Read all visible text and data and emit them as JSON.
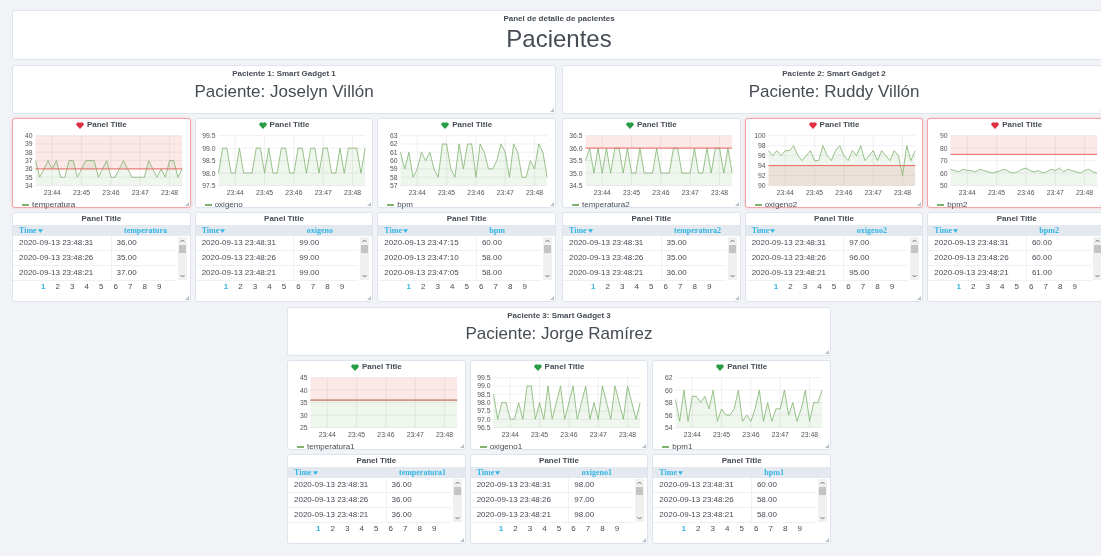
{
  "header": {
    "subtitle": "Panel de detalle de pacientes",
    "title": "Pacientes"
  },
  "patients": [
    {
      "subtitle": "Paciente 1: Smart Gadget 1",
      "title": "Paciente: Joselyn Villón",
      "graphs": [
        {
          "title": "Panel Title",
          "alerting": true,
          "chart_data": {
            "type": "area",
            "grid": true,
            "ylim": [
              34,
              40
            ],
            "yticks": [
              {
                "value": 34,
                "label": "34"
              },
              {
                "value": 35,
                "label": "35"
              },
              {
                "value": 36,
                "label": "36"
              },
              {
                "value": 37,
                "label": "37"
              },
              {
                "value": 38,
                "label": "38"
              },
              {
                "value": 39,
                "label": "39"
              },
              {
                "value": 40,
                "label": "40"
              }
            ],
            "ref_lines": [
              {
                "axis": "y",
                "value": 36
              }
            ],
            "bands": [
              {
                "axis": "y",
                "from": 36,
                "to": 40
              }
            ],
            "categories": [
              null,
              null,
              null,
              null,
              "23:44",
              null,
              null,
              null,
              null,
              null,
              null,
              "23:45",
              null,
              null,
              null,
              null,
              null,
              null,
              "23:46",
              null,
              null,
              null,
              null,
              null,
              null,
              "23:47",
              null,
              null,
              null,
              null,
              null,
              null,
              "23:48",
              null,
              null,
              null
            ],
            "series": [
              {
                "name": "temperatura",
                "color": "#7eb26d",
                "values": [
                  37,
                  35,
                  36,
                  37,
                  36,
                  37,
                  35,
                  35,
                  37,
                  37,
                  35,
                  36,
                  37,
                  37,
                  37,
                  35,
                  36,
                  37,
                  35,
                  35,
                  36,
                  37,
                  36,
                  35,
                  35,
                  35,
                  35,
                  37,
                  36,
                  35,
                  36,
                  35,
                  37,
                  37,
                  35,
                  36
                ]
              }
            ]
          }
        },
        {
          "title": "Panel Title",
          "alerting": false,
          "chart_data": {
            "type": "area",
            "grid": true,
            "ylim": [
              97.5,
              99.5
            ],
            "yticks": [
              {
                "value": 97.5,
                "label": "97.5"
              },
              {
                "value": 98,
                "label": "98.0"
              },
              {
                "value": 98.5,
                "label": "98.5"
              },
              {
                "value": 99,
                "label": "99.0"
              },
              {
                "value": 99.5,
                "label": "99.5"
              }
            ],
            "categories": [
              null,
              null,
              null,
              null,
              "23:44",
              null,
              null,
              null,
              null,
              null,
              null,
              "23:45",
              null,
              null,
              null,
              null,
              null,
              null,
              "23:46",
              null,
              null,
              null,
              null,
              null,
              null,
              "23:47",
              null,
              null,
              null,
              null,
              null,
              null,
              "23:48",
              null,
              null,
              null
            ],
            "series": [
              {
                "name": "oxigeno",
                "color": "#7eb26d",
                "values": [
                  98,
                  99,
                  99,
                  98,
                  98,
                  99,
                  98,
                  98,
                  98,
                  99,
                  99,
                  98,
                  99,
                  98,
                  98,
                  99,
                  99,
                  98,
                  98,
                  99,
                  99,
                  98,
                  99,
                  99,
                  98,
                  99,
                  99,
                  98,
                  98,
                  99,
                  98,
                  99,
                  99,
                  99,
                  98,
                  99
                ]
              }
            ]
          }
        },
        {
          "title": "Panel Title",
          "alerting": false,
          "chart_data": {
            "type": "area",
            "grid": true,
            "ylim": [
              57,
              63
            ],
            "yticks": [
              {
                "value": 57,
                "label": "57"
              },
              {
                "value": 58,
                "label": "58"
              },
              {
                "value": 59,
                "label": "59"
              },
              {
                "value": 60,
                "label": "60"
              },
              {
                "value": 61,
                "label": "61"
              },
              {
                "value": 62,
                "label": "62"
              },
              {
                "value": 63,
                "label": "63"
              }
            ],
            "categories": [
              null,
              null,
              null,
              null,
              "23:44",
              null,
              null,
              null,
              null,
              null,
              null,
              "23:45",
              null,
              null,
              null,
              null,
              null,
              null,
              "23:46",
              null,
              null,
              null,
              null,
              null,
              null,
              "23:47",
              null,
              null,
              null,
              null,
              null,
              null,
              "23:48",
              null,
              null,
              null
            ],
            "series": [
              {
                "name": "bpm",
                "color": "#7eb26d",
                "values": [
                  61,
                  59,
                  61,
                  58,
                  59,
                  61,
                  60,
                  61,
                  59,
                  58,
                  62,
                  62,
                  59,
                  58,
                  62,
                  59,
                  62,
                  62,
                  58,
                  62,
                  61,
                  59,
                  59,
                  60,
                  62,
                  61,
                  58,
                  62,
                  61,
                  58,
                  58,
                  60,
                  59,
                  62,
                  61,
                  58
                ]
              }
            ]
          }
        }
      ],
      "tables": [
        {
          "title": "Panel Title",
          "columns": [
            {
              "label": "Time",
              "sorted": true
            },
            {
              "label": "temperatura",
              "sorted": false
            }
          ],
          "rows": [
            [
              "2020-09-13 23:48:31",
              "36.00"
            ],
            [
              "2020-09-13 23:48:26",
              "35.00"
            ],
            [
              "2020-09-13 23:48:21",
              "37.00"
            ]
          ],
          "pages": [
            {
              "label": "1",
              "selected": true
            },
            {
              "label": "2",
              "selected": false
            },
            {
              "label": "3",
              "selected": false
            },
            {
              "label": "4",
              "selected": false
            },
            {
              "label": "5",
              "selected": false
            },
            {
              "label": "6",
              "selected": false
            },
            {
              "label": "7",
              "selected": false
            },
            {
              "label": "8",
              "selected": false
            },
            {
              "label": "9",
              "selected": false
            }
          ]
        },
        {
          "title": "Panel Title",
          "columns": [
            {
              "label": "Time",
              "sorted": true
            },
            {
              "label": "oxigeno",
              "sorted": false
            }
          ],
          "rows": [
            [
              "2020-09-13 23:48:31",
              "99.00"
            ],
            [
              "2020-09-13 23:48:26",
              "99.00"
            ],
            [
              "2020-09-13 23:48:21",
              "99.00"
            ]
          ],
          "pages": [
            {
              "label": "1",
              "selected": true
            },
            {
              "label": "2",
              "selected": false
            },
            {
              "label": "3",
              "selected": false
            },
            {
              "label": "4",
              "selected": false
            },
            {
              "label": "5",
              "selected": false
            },
            {
              "label": "6",
              "selected": false
            },
            {
              "label": "7",
              "selected": false
            },
            {
              "label": "8",
              "selected": false
            },
            {
              "label": "9",
              "selected": false
            }
          ]
        },
        {
          "title": "Panel Title",
          "columns": [
            {
              "label": "Time",
              "sorted": true
            },
            {
              "label": "bpm",
              "sorted": false
            }
          ],
          "rows": [
            [
              "2020-09-13 23:47:15",
              "60.00"
            ],
            [
              "2020-09-13 23:47:10",
              "58.00"
            ],
            [
              "2020-09-13 23:47:05",
              "58.00"
            ]
          ],
          "pages": [
            {
              "label": "1",
              "selected": true
            },
            {
              "label": "2",
              "selected": false
            },
            {
              "label": "3",
              "selected": false
            },
            {
              "label": "4",
              "selected": false
            },
            {
              "label": "5",
              "selected": false
            },
            {
              "label": "6",
              "selected": false
            },
            {
              "label": "7",
              "selected": false
            },
            {
              "label": "8",
              "selected": false
            },
            {
              "label": "9",
              "selected": false
            }
          ]
        }
      ]
    },
    {
      "subtitle": "Paciente 2: Smart Gadget 2",
      "title": "Paciente: Ruddy Villón",
      "graphs": [
        {
          "title": "Panel Title",
          "alerting": false,
          "chart_data": {
            "type": "area",
            "grid": true,
            "ylim": [
              34.5,
              36.5
            ],
            "yticks": [
              {
                "value": 34.5,
                "label": "34.5"
              },
              {
                "value": 35,
                "label": "35.0"
              },
              {
                "value": 35.5,
                "label": "35.5"
              },
              {
                "value": 36,
                "label": "36.0"
              },
              {
                "value": 36.5,
                "label": "36.5"
              }
            ],
            "ref_lines": [
              {
                "axis": "y",
                "value": 36
              }
            ],
            "bands": [
              {
                "axis": "y",
                "from": 36,
                "to": 36.5
              }
            ],
            "categories": [
              null,
              null,
              null,
              null,
              "23:44",
              null,
              null,
              null,
              null,
              null,
              null,
              "23:45",
              null,
              null,
              null,
              null,
              null,
              null,
              "23:46",
              null,
              null,
              null,
              null,
              null,
              null,
              "23:47",
              null,
              null,
              null,
              null,
              null,
              null,
              "23:48",
              null,
              null,
              null
            ],
            "series": [
              {
                "name": "temperatura2",
                "color": "#7eb26d",
                "values": [
                  35.5,
                  36,
                  35,
                  36,
                  35,
                  36,
                  35,
                  36,
                  36,
                  35,
                  36,
                  35,
                  35,
                  36,
                  35,
                  35,
                  35,
                  36,
                  35,
                  35,
                  35,
                  36,
                  36,
                  35,
                  35,
                  35,
                  36,
                  35,
                  35,
                  36,
                  35,
                  36,
                  36,
                  35,
                  36,
                  35
                ]
              }
            ]
          }
        },
        {
          "title": "Panel Title",
          "alerting": true,
          "chart_data": {
            "type": "area",
            "grid": true,
            "ylim": [
              90,
              100
            ],
            "yticks": [
              {
                "value": 90,
                "label": "90"
              },
              {
                "value": 92,
                "label": "92"
              },
              {
                "value": 94,
                "label": "94"
              },
              {
                "value": 96,
                "label": "96"
              },
              {
                "value": 98,
                "label": "98"
              },
              {
                "value": 100,
                "label": "100"
              }
            ],
            "ref_lines": [
              {
                "axis": "y",
                "value": 94
              }
            ],
            "bands": [
              {
                "axis": "y",
                "from": 90,
                "to": 94
              }
            ],
            "categories": [
              null,
              null,
              null,
              null,
              "23:44",
              null,
              null,
              null,
              null,
              null,
              null,
              "23:45",
              null,
              null,
              null,
              null,
              null,
              null,
              "23:46",
              null,
              null,
              null,
              null,
              null,
              null,
              "23:47",
              null,
              null,
              null,
              null,
              null,
              null,
              "23:48",
              null,
              null,
              null
            ],
            "series": [
              {
                "name": "oxigeno2",
                "color": "#7eb26d",
                "values": [
                  97,
                  96,
                  97,
                  96,
                  97,
                  97,
                  98,
                  96,
                  95,
                  96,
                  97,
                  95,
                  95,
                  98,
                  96,
                  95,
                  97,
                  98,
                  96,
                  95,
                  97,
                  96,
                  98,
                  95,
                  96,
                  97,
                  95,
                  97,
                  96,
                  95,
                  97,
                  96,
                  92,
                  98,
                  95,
                  97
                ]
              }
            ]
          }
        },
        {
          "title": "Panel Title",
          "alerting": true,
          "chart_data": {
            "type": "area",
            "grid": true,
            "ylim": [
              50,
              90
            ],
            "yticks": [
              {
                "value": 50,
                "label": "50"
              },
              {
                "value": 60,
                "label": "60"
              },
              {
                "value": 70,
                "label": "70"
              },
              {
                "value": 80,
                "label": "80"
              },
              {
                "value": 90,
                "label": "90"
              }
            ],
            "ref_lines": [
              {
                "axis": "y",
                "value": 75
              }
            ],
            "bands": [
              {
                "axis": "y",
                "from": 75,
                "to": 90
              }
            ],
            "categories": [
              null,
              null,
              null,
              null,
              "23:44",
              null,
              null,
              null,
              null,
              null,
              null,
              "23:45",
              null,
              null,
              null,
              null,
              null,
              null,
              "23:46",
              null,
              null,
              null,
              null,
              null,
              null,
              "23:47",
              null,
              null,
              null,
              null,
              null,
              null,
              "23:48",
              null,
              null,
              null
            ],
            "series": [
              {
                "name": "bpm2",
                "color": "#7eb26d",
                "values": [
                  63,
                  62,
                  61,
                  63,
                  62,
                  62,
                  61,
                  63,
                  62,
                  61,
                  60,
                  61,
                  62,
                  63,
                  61,
                  60,
                  61,
                  63,
                  64,
                  62,
                  61,
                  62,
                  60,
                  61,
                  63,
                  62,
                  64,
                  61,
                  63,
                  62,
                  61,
                  60,
                  62,
                  63,
                  61,
                  60
                ]
              }
            ]
          }
        }
      ],
      "tables": [
        {
          "title": "Panel Title",
          "columns": [
            {
              "label": "Time",
              "sorted": true
            },
            {
              "label": "temperatura2",
              "sorted": false
            }
          ],
          "rows": [
            [
              "2020-09-13 23:48:31",
              "35.00"
            ],
            [
              "2020-09-13 23:48:26",
              "35.00"
            ],
            [
              "2020-09-13 23:48:21",
              "36.00"
            ]
          ],
          "pages": [
            {
              "label": "1",
              "selected": true
            },
            {
              "label": "2",
              "selected": false
            },
            {
              "label": "3",
              "selected": false
            },
            {
              "label": "4",
              "selected": false
            },
            {
              "label": "5",
              "selected": false
            },
            {
              "label": "6",
              "selected": false
            },
            {
              "label": "7",
              "selected": false
            },
            {
              "label": "8",
              "selected": false
            },
            {
              "label": "9",
              "selected": false
            }
          ]
        },
        {
          "title": "Panel Title",
          "columns": [
            {
              "label": "Time",
              "sorted": true
            },
            {
              "label": "oxigeno2",
              "sorted": false
            }
          ],
          "rows": [
            [
              "2020-09-13 23:48:31",
              "97.00"
            ],
            [
              "2020-09-13 23:48:26",
              "96.00"
            ],
            [
              "2020-09-13 23:48:21",
              "95.00"
            ]
          ],
          "pages": [
            {
              "label": "1",
              "selected": true
            },
            {
              "label": "2",
              "selected": false
            },
            {
              "label": "3",
              "selected": false
            },
            {
              "label": "4",
              "selected": false
            },
            {
              "label": "5",
              "selected": false
            },
            {
              "label": "6",
              "selected": false
            },
            {
              "label": "7",
              "selected": false
            },
            {
              "label": "8",
              "selected": false
            },
            {
              "label": "9",
              "selected": false
            }
          ]
        },
        {
          "title": "Panel Title",
          "columns": [
            {
              "label": "Time",
              "sorted": true
            },
            {
              "label": "bpm2",
              "sorted": false
            }
          ],
          "rows": [
            [
              "2020-09-13 23:48:31",
              "60.00"
            ],
            [
              "2020-09-13 23:48:26",
              "60.00"
            ],
            [
              "2020-09-13 23:48:21",
              "61.00"
            ]
          ],
          "pages": [
            {
              "label": "1",
              "selected": true
            },
            {
              "label": "2",
              "selected": false
            },
            {
              "label": "3",
              "selected": false
            },
            {
              "label": "4",
              "selected": false
            },
            {
              "label": "5",
              "selected": false
            },
            {
              "label": "6",
              "selected": false
            },
            {
              "label": "7",
              "selected": false
            },
            {
              "label": "8",
              "selected": false
            },
            {
              "label": "9",
              "selected": false
            }
          ]
        }
      ]
    },
    {
      "subtitle": "Paciente 3: Smart Gadget 3",
      "title": "Paciente: Jorge Ramírez",
      "graphs": [
        {
          "title": "Panel Title",
          "alerting": false,
          "chart_data": {
            "type": "area",
            "grid": true,
            "ylim": [
              25,
              45
            ],
            "yticks": [
              {
                "value": 25,
                "label": "25"
              },
              {
                "value": 30,
                "label": "30"
              },
              {
                "value": 35,
                "label": "35"
              },
              {
                "value": 40,
                "label": "40"
              },
              {
                "value": 45,
                "label": "45"
              }
            ],
            "ref_lines": [
              {
                "axis": "y",
                "value": 36
              }
            ],
            "bands": [
              {
                "axis": "y",
                "from": 36,
                "to": 45
              }
            ],
            "categories": [
              null,
              null,
              null,
              null,
              "23:44",
              null,
              null,
              null,
              null,
              null,
              null,
              "23:45",
              null,
              null,
              null,
              null,
              null,
              null,
              "23:46",
              null,
              null,
              null,
              null,
              null,
              null,
              "23:47",
              null,
              null,
              null,
              null,
              null,
              null,
              "23:48",
              null,
              null,
              null
            ],
            "series": [
              {
                "name": "temperatura1",
                "color": "#7eb26d",
                "values": [
                  36,
                  36,
                  36,
                  36,
                  36,
                  36,
                  36,
                  36,
                  36,
                  36,
                  36,
                  36,
                  36,
                  36,
                  36,
                  36,
                  36,
                  36,
                  36,
                  36,
                  36,
                  36,
                  36,
                  36,
                  36,
                  36,
                  36,
                  36,
                  36,
                  36,
                  36,
                  36,
                  36,
                  36,
                  36,
                  36
                ]
              }
            ]
          }
        },
        {
          "title": "Panel Title",
          "alerting": false,
          "chart_data": {
            "type": "area",
            "grid": true,
            "ylim": [
              96.5,
              99.5
            ],
            "yticks": [
              {
                "value": 96.5,
                "label": "96.5"
              },
              {
                "value": 97,
                "label": "97.0"
              },
              {
                "value": 97.5,
                "label": "97.5"
              },
              {
                "value": 98,
                "label": "98.0"
              },
              {
                "value": 98.5,
                "label": "98.5"
              },
              {
                "value": 99,
                "label": "99.0"
              },
              {
                "value": 99.5,
                "label": "99.5"
              }
            ],
            "categories": [
              null,
              null,
              null,
              null,
              "23:44",
              null,
              null,
              null,
              null,
              null,
              null,
              "23:45",
              null,
              null,
              null,
              null,
              null,
              null,
              "23:46",
              null,
              null,
              null,
              null,
              null,
              null,
              "23:47",
              null,
              null,
              null,
              null,
              null,
              null,
              "23:48",
              null,
              null,
              null
            ],
            "series": [
              {
                "name": "oxigeno1",
                "color": "#7eb26d",
                "values": [
                  98.5,
                  97,
                  98,
                  98,
                  97,
                  97,
                  98,
                  97,
                  99,
                  99,
                  97,
                  98,
                  97,
                  99,
                  97,
                  98,
                  99,
                  97,
                  98,
                  99,
                  97,
                  98,
                  99,
                  97,
                  98,
                  97,
                  99,
                  98,
                  97,
                  99,
                  98,
                  97,
                  99,
                  98,
                  97,
                  98
                ]
              }
            ]
          }
        },
        {
          "title": "Panel Title",
          "alerting": false,
          "chart_data": {
            "type": "area",
            "grid": true,
            "ylim": [
              54,
              62
            ],
            "yticks": [
              {
                "value": 54,
                "label": "54"
              },
              {
                "value": 56,
                "label": "56"
              },
              {
                "value": 58,
                "label": "58"
              },
              {
                "value": 60,
                "label": "60"
              },
              {
                "value": 62,
                "label": "62"
              }
            ],
            "categories": [
              null,
              null,
              null,
              null,
              "23:44",
              null,
              null,
              null,
              null,
              null,
              null,
              "23:45",
              null,
              null,
              null,
              null,
              null,
              null,
              "23:46",
              null,
              null,
              null,
              null,
              null,
              null,
              "23:47",
              null,
              null,
              null,
              null,
              null,
              null,
              "23:48",
              null,
              null,
              null
            ],
            "series": [
              {
                "name": "bpm1",
                "color": "#7eb26d",
                "values": [
                  58.5,
                  55,
                  60,
                  55,
                  59,
                  59,
                  58,
                  59,
                  57,
                  60,
                  55,
                  57,
                  56,
                  56,
                  57,
                  60,
                  55,
                  56,
                  55,
                  57,
                  60,
                  55,
                  58,
                  55,
                  57,
                  57,
                  60,
                  56,
                  58,
                  55,
                  57,
                  60,
                  55,
                  58,
                  58,
                  60
                ]
              }
            ]
          }
        }
      ],
      "tables": [
        {
          "title": "Panel Title",
          "columns": [
            {
              "label": "Time",
              "sorted": true
            },
            {
              "label": "temperatura1",
              "sorted": false
            }
          ],
          "rows": [
            [
              "2020-09-13 23:48:31",
              "36.00"
            ],
            [
              "2020-09-13 23:48:26",
              "36.00"
            ],
            [
              "2020-09-13 23:48:21",
              "36.00"
            ]
          ],
          "pages": [
            {
              "label": "1",
              "selected": true
            },
            {
              "label": "2",
              "selected": false
            },
            {
              "label": "3",
              "selected": false
            },
            {
              "label": "4",
              "selected": false
            },
            {
              "label": "5",
              "selected": false
            },
            {
              "label": "6",
              "selected": false
            },
            {
              "label": "7",
              "selected": false
            },
            {
              "label": "8",
              "selected": false
            },
            {
              "label": "9",
              "selected": false
            }
          ]
        },
        {
          "title": "Panel Title",
          "columns": [
            {
              "label": "Time",
              "sorted": true
            },
            {
              "label": "oxigeno1",
              "sorted": false
            }
          ],
          "rows": [
            [
              "2020-09-13 23:48:31",
              "98.00"
            ],
            [
              "2020-09-13 23:48:26",
              "97.00"
            ],
            [
              "2020-09-13 23:48:21",
              "98.00"
            ]
          ],
          "pages": [
            {
              "label": "1",
              "selected": true
            },
            {
              "label": "2",
              "selected": false
            },
            {
              "label": "3",
              "selected": false
            },
            {
              "label": "4",
              "selected": false
            },
            {
              "label": "5",
              "selected": false
            },
            {
              "label": "6",
              "selected": false
            },
            {
              "label": "7",
              "selected": false
            },
            {
              "label": "8",
              "selected": false
            },
            {
              "label": "9",
              "selected": false
            }
          ]
        },
        {
          "title": "Panel Title",
          "columns": [
            {
              "label": "Time",
              "sorted": true
            },
            {
              "label": "bpm1",
              "sorted": false
            }
          ],
          "rows": [
            [
              "2020-09-13 23:48:31",
              "60.00"
            ],
            [
              "2020-09-13 23:48:26",
              "58.00"
            ],
            [
              "2020-09-13 23:48:21",
              "58.00"
            ]
          ],
          "pages": [
            {
              "label": "1",
              "selected": true
            },
            {
              "label": "2",
              "selected": false
            },
            {
              "label": "3",
              "selected": false
            },
            {
              "label": "4",
              "selected": false
            },
            {
              "label": "5",
              "selected": false
            },
            {
              "label": "6",
              "selected": false
            },
            {
              "label": "7",
              "selected": false
            },
            {
              "label": "8",
              "selected": false
            },
            {
              "label": "9",
              "selected": false
            }
          ]
        }
      ]
    }
  ]
}
